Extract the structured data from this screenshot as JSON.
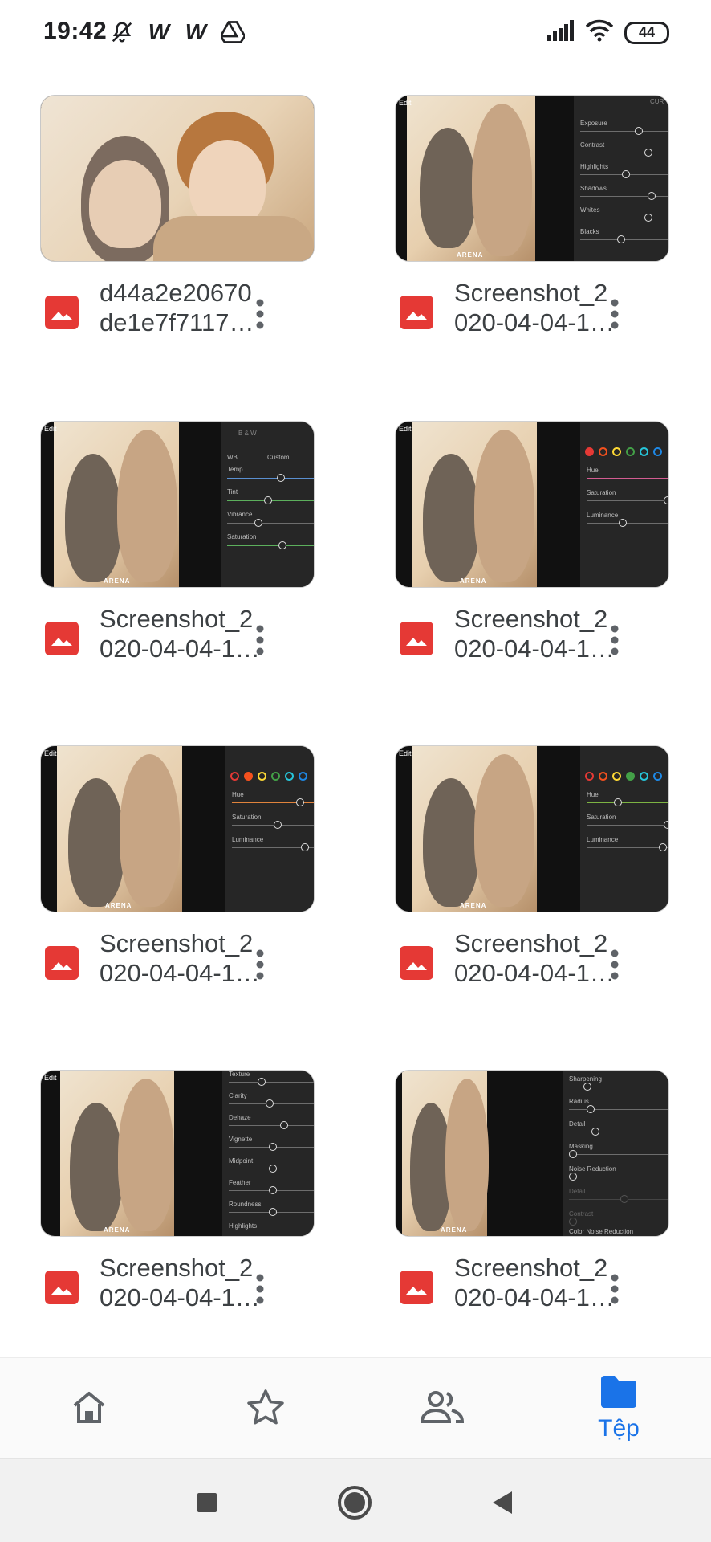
{
  "status_bar": {
    "time": "19:42",
    "battery": "44",
    "left_icons": [
      "mute-icon",
      "w-icon",
      "w-icon",
      "drive-icon"
    ],
    "right_icons": [
      "signal-icon",
      "wifi-icon",
      "battery-icon"
    ]
  },
  "files": [
    {
      "name_line1": "d44a2e20670",
      "name_line2": "de1e7f7117…",
      "type_icon": "image-file-icon"
    },
    {
      "name_line1": "Screenshot_2",
      "name_line2": "020-04-04-1…",
      "type_icon": "image-file-icon",
      "panel_labels": [
        "Exposure",
        "Contrast",
        "Highlights",
        "Shadows",
        "Whites",
        "Blacks"
      ]
    },
    {
      "name_line1": "Screenshot_2",
      "name_line2": "020-04-04-1…",
      "type_icon": "image-file-icon",
      "panel_header": "B & W",
      "panel_wb": "WB",
      "panel_wb_value": "Custom",
      "panel_labels": [
        "Temp",
        "Tint",
        "Vibrance",
        "Saturation"
      ]
    },
    {
      "name_line1": "Screenshot_2",
      "name_line2": "020-04-04-1…",
      "type_icon": "image-file-icon",
      "panel_labels": [
        "Hue",
        "Saturation",
        "Luminance"
      ]
    },
    {
      "name_line1": "Screenshot_2",
      "name_line2": "020-04-04-1…",
      "type_icon": "image-file-icon",
      "panel_labels": [
        "Hue",
        "Saturation",
        "Luminance"
      ]
    },
    {
      "name_line1": "Screenshot_2",
      "name_line2": "020-04-04-1…",
      "type_icon": "image-file-icon",
      "panel_labels": [
        "Hue",
        "Saturation",
        "Luminance"
      ]
    },
    {
      "name_line1": "Screenshot_2",
      "name_line2": "020-04-04-1…",
      "type_icon": "image-file-icon",
      "panel_labels": [
        "Texture",
        "Clarity",
        "Dehaze",
        "Vignette",
        "Midpoint",
        "Feather",
        "Roundness",
        "Highlights"
      ]
    },
    {
      "name_line1": "Screenshot_2",
      "name_line2": "020-04-04-1…",
      "type_icon": "image-file-icon",
      "panel_labels": [
        "Sharpening",
        "Radius",
        "Detail",
        "Masking",
        "Noise Reduction",
        "Detail",
        "Contrast",
        "Color Noise Reduction"
      ]
    }
  ],
  "thumb_texts": {
    "edit": "Edit",
    "watermark": "ARENA",
    "curve": "CUR"
  },
  "bottom_nav": [
    {
      "id": "home",
      "icon": "home-icon",
      "label": ""
    },
    {
      "id": "starred",
      "icon": "star-icon",
      "label": ""
    },
    {
      "id": "shared",
      "icon": "people-icon",
      "label": ""
    },
    {
      "id": "files",
      "icon": "folder-icon",
      "label": "Tệp",
      "active": true
    }
  ],
  "colors": {
    "accent": "#1a73e8",
    "file_icon": "#e53935",
    "panel": "#262626"
  }
}
